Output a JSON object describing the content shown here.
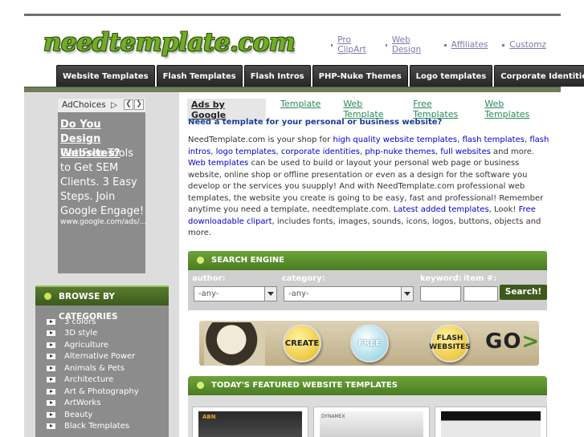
{
  "site": {
    "logo_text": "needtemplate.com"
  },
  "top_links": [
    {
      "label": "Pro ClipArt"
    },
    {
      "label": "Web Design"
    },
    {
      "label": "Affiliates"
    },
    {
      "label": "Customz"
    }
  ],
  "nav_tabs": [
    {
      "label": "Website Templates"
    },
    {
      "label": "Flash Templates"
    },
    {
      "label": "Flash Intros"
    },
    {
      "label": "PHP-Nuke Themes"
    },
    {
      "label": "Logo templates"
    },
    {
      "label": "Corporate Identities"
    }
  ],
  "sidebar_ad": {
    "adchoices_label": "AdChoices",
    "headline": "Do You Design Websites?",
    "body": "Get Free Tools to Get SEM Clients. 3 Easy Steps. Join Google Engage!",
    "url": "www.google.com/ads/..."
  },
  "categories": {
    "title": "BROWSE BY CATEGORIES",
    "items": [
      "3 colors",
      "3D style",
      "Agriculture",
      "Alternative Power",
      "Animals & Pets",
      "Architecture",
      "Art & Photography",
      "ArtWorks",
      "Beauty",
      "Black Templates"
    ]
  },
  "ads_row": {
    "ads_by": "Ads by Google",
    "links": [
      "Template",
      "Web Template",
      "Free Templates",
      "Web Templates"
    ]
  },
  "intro": {
    "question": "Need a template for your personal or business website?",
    "t1": "NeedTemplate.com is your shop for ",
    "l1": "high quality website templates",
    "t2": ", ",
    "l2": "flash templates",
    "t3": ", ",
    "l3": "flash intros",
    "t4": ", ",
    "l4": "logo templates",
    "t5": ", ",
    "l5": "corporate identities",
    "t6": ", ",
    "l6": "php-nuke themes",
    "t7": ", ",
    "l7": "full websites",
    "t8": " and more. ",
    "l8": "Web templates",
    "t9": " can be used to build or layout your personal web page or business website, online shop or offline presentation or even as a design for the software you develop or the services you suupply! And with NeedTemplate.com professional web templates, the website you create is going to be easy, fast and professional! Remember anytime you need a template, needtemplate.com. ",
    "l9": "Latest added templates",
    "t10": ", Look! ",
    "l10": "Free downloadable clipart",
    "t11": ", includes fonts, images, sounds, icons, logos, buttons, objects and more."
  },
  "search": {
    "title": "SEARCH ENGINE",
    "author_label": "author:",
    "category_label": "category:",
    "keyword_label": "keyword:",
    "item_label": "item #:",
    "author_value": "-any-",
    "category_value": "-any-",
    "button_label": "Search!"
  },
  "banner": {
    "btn_create": "CREATE",
    "btn_free": "FREE",
    "btn_flash": "FLASH WEBSITES",
    "go_text": "GO",
    "go_arrow": ">"
  },
  "featured": {
    "title": "TODAY'S FEATURED WEBSITE TEMPLATES",
    "thumb1_text": "ABN",
    "thumb2_text": "DYNAMEX"
  },
  "colors": {
    "accent_green": "#4a7c22",
    "tab_dark": "#262626",
    "sidebar_gray": "#8c8c8c",
    "link_blue": "#0000cc"
  }
}
